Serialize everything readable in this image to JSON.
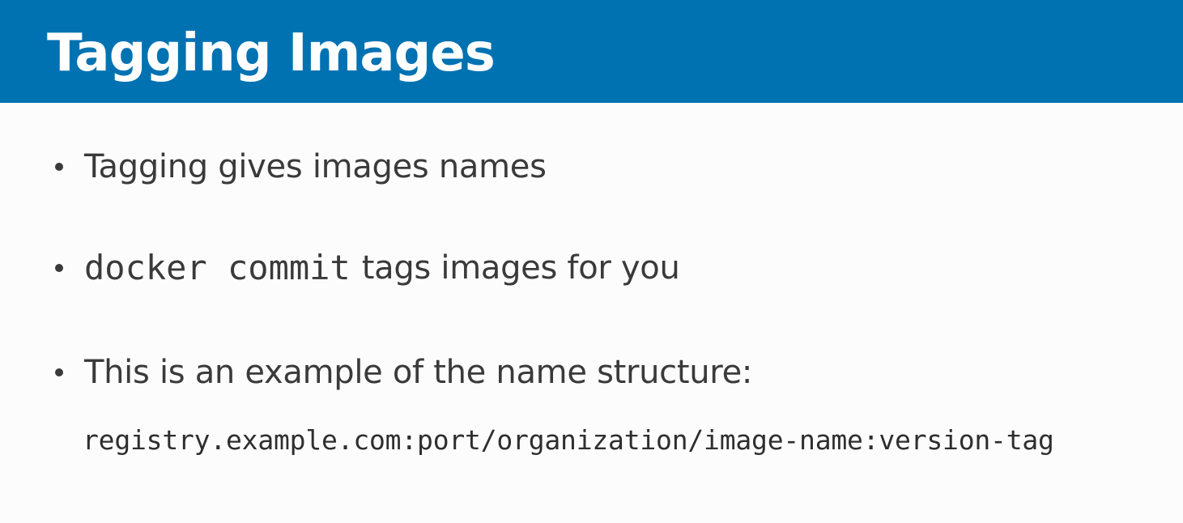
{
  "slide": {
    "title": "Tagging Images",
    "bullets": {
      "first": "Tagging gives images names",
      "second_code": "docker commit",
      "second_text": "tags images for you",
      "third": "This is an example of the name structure:"
    },
    "example": "registry.example.com:port/organization/image-name:version-tag"
  },
  "colors": {
    "title_bar": "#0072b2",
    "title_text": "#ffffff",
    "body_text": "#3a3a3a",
    "background": "#fcfcfc"
  }
}
